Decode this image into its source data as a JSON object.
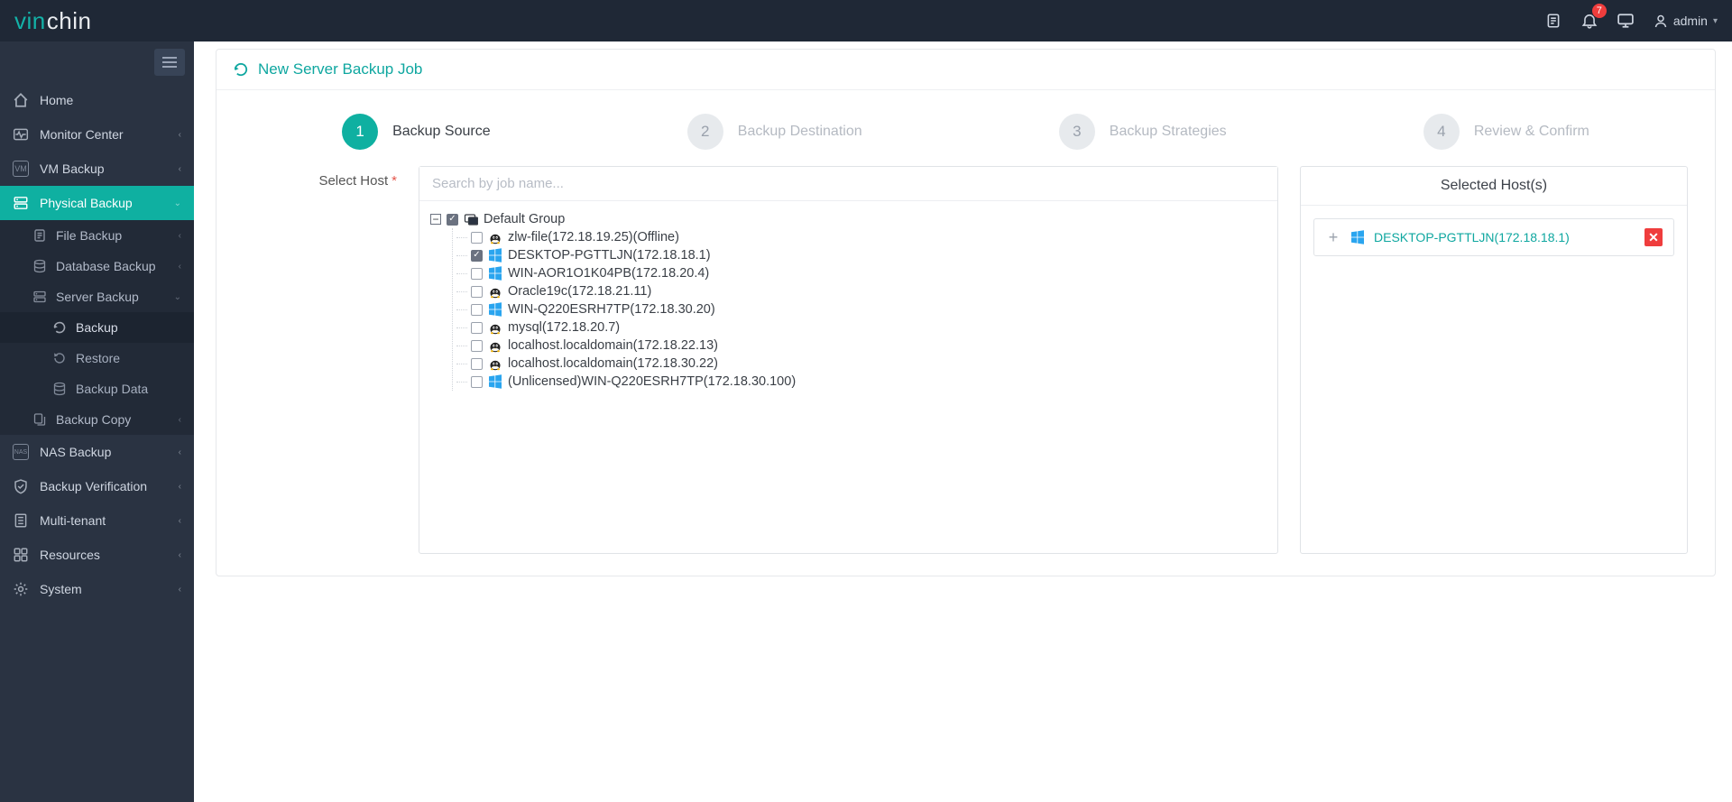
{
  "brand": {
    "prefix": "vin",
    "suffix": "chin"
  },
  "topbar": {
    "notif_count": "7",
    "username": "admin"
  },
  "sidebar": {
    "home": "Home",
    "monitor": "Monitor Center",
    "vm": "VM Backup",
    "physical": "Physical Backup",
    "file": "File Backup",
    "db": "Database Backup",
    "server": "Server Backup",
    "backup": "Backup",
    "restore": "Restore",
    "backup_data": "Backup Data",
    "copy": "Backup Copy",
    "nas": "NAS Backup",
    "verify": "Backup Verification",
    "tenant": "Multi-tenant",
    "resources": "Resources",
    "system": "System"
  },
  "page": {
    "title": "New Server Backup Job",
    "steps": {
      "s1": "Backup Source",
      "s2": "Backup Destination",
      "s3": "Backup Strategies",
      "s4": "Review & Confirm",
      "n1": "1",
      "n2": "2",
      "n3": "3",
      "n4": "4"
    },
    "select_host_label": "Select Host",
    "search_placeholder": "Search by job name...",
    "group_label": "Default Group",
    "hosts": {
      "h0": "zlw-file(172.18.19.25)(Offline)",
      "h1": "DESKTOP-PGTTLJN(172.18.18.1)",
      "h2": "WIN-AOR1O1K04PB(172.18.20.4)",
      "h3": "Oracle19c(172.18.21.11)",
      "h4": "WIN-Q220ESRH7TP(172.18.30.20)",
      "h5": "mysql(172.18.20.7)",
      "h6": "localhost.localdomain(172.18.22.13)",
      "h7": "localhost.localdomain(172.18.30.22)",
      "h8": "(Unlicensed)WIN-Q220ESRH7TP(172.18.30.100)"
    },
    "selected_header": "Selected Host(s)",
    "selected_name": "DESKTOP-PGTTLJN(172.18.18.1)"
  }
}
